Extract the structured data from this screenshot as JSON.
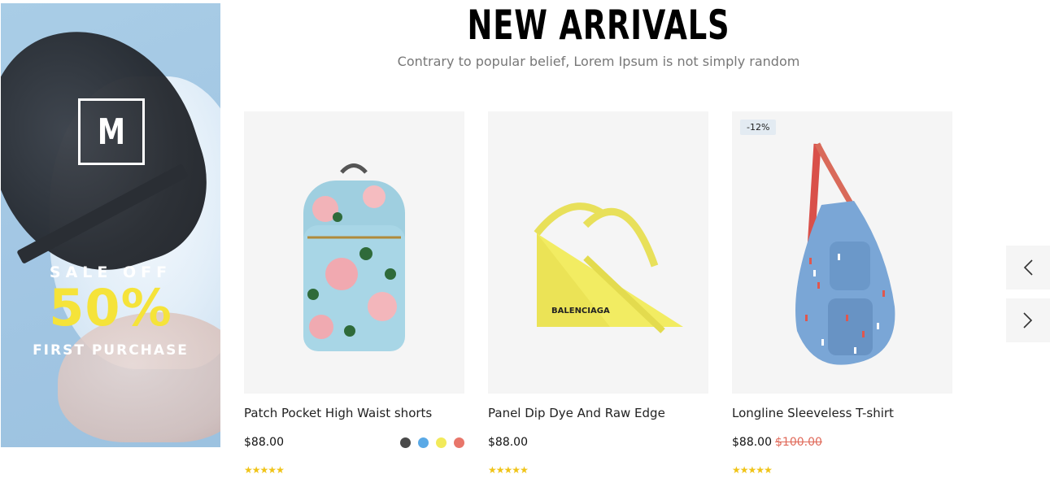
{
  "banner": {
    "logo_letter": "M",
    "sale_off": "SALE OFF",
    "percent": "50%",
    "first_purchase": "FIRST PURCHASE"
  },
  "section": {
    "title": "NEW ARRIVALS",
    "subtitle": "Contrary to popular belief, Lorem Ipsum is not simply random"
  },
  "products": [
    {
      "name": "Patch Pocket High Waist shorts",
      "price": "$88.00",
      "rating": 5,
      "swatches": [
        "#4a4a4a",
        "#5aa9e6",
        "#f2ea5a",
        "#e8766a"
      ]
    },
    {
      "name": "Panel Dip Dye And Raw Edge",
      "price": "$88.00",
      "rating": 5,
      "brand_text": "BALENCIAGA"
    },
    {
      "name": "Longline Sleeveless T-shirt",
      "price": "$88.00",
      "old_price": "$100.00",
      "badge": "-12%",
      "rating": 5
    }
  ],
  "colors": {
    "accent_yellow": "#f5e33a",
    "star_color": "#f0c419",
    "old_price_color": "#e06a5a"
  },
  "icons": {
    "prev": "chevron-left-icon",
    "next": "chevron-right-icon",
    "star": "star-icon"
  }
}
